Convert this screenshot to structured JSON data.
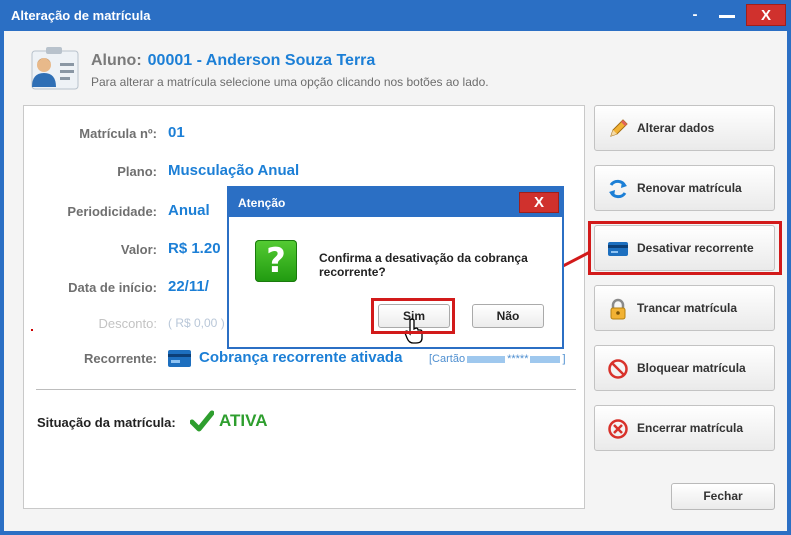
{
  "window": {
    "title": "Alteração de matrícula",
    "help_label": "-",
    "close_label": "X"
  },
  "header": {
    "aluno_label": "Aluno:",
    "aluno_value": "00001 - Anderson Souza Terra",
    "hint": "Para alterar a matrícula selecione uma opção clicando nos botões ao lado."
  },
  "info": {
    "matricula_label": "Matrícula nº:",
    "matricula_value": "01",
    "plano_label": "Plano:",
    "plano_value": "Musculação Anual",
    "periodicidade_label": "Periodicidade:",
    "periodicidade_value": "Anual",
    "valor_label": "Valor:",
    "valor_value": "R$ 1.20",
    "data_label": "Data de início:",
    "data_value": "22/11/",
    "desconto_label": "Desconto:",
    "desconto_value": "( R$ 0,00 )",
    "recorrente_label": "Recorrente:",
    "recorrente_value": "Cobrança recorrente ativada",
    "cartao_prefix": "[Cartão",
    "cartao_mask": "*****",
    "cartao_suffix": "]",
    "situacao_label": "Situação da matrícula:",
    "situacao_value": "ATIVA"
  },
  "actions": [
    {
      "label": "Alterar dados",
      "icon": "pencil-icon"
    },
    {
      "label": "Renovar matrícula",
      "icon": "refresh-icon"
    },
    {
      "label": "Desativar recorrente",
      "icon": "credit-card-icon"
    },
    {
      "label": "Trancar matrícula",
      "icon": "lock-icon"
    },
    {
      "label": "Bloquear matrícula",
      "icon": "block-icon"
    },
    {
      "label": "Encerrar matrícula",
      "icon": "cancel-circle-icon"
    }
  ],
  "fechar_label": "Fechar",
  "dialog": {
    "title": "Atenção",
    "close_label": "X",
    "message": "Confirma a desativação da cobrança recorrente?",
    "yes_label": "Sim",
    "no_label": "Não",
    "icon": "question-icon"
  },
  "colors": {
    "titlebar": "#2b6fc4",
    "accent_text": "#1c7fd6",
    "highlight": "#d21a1a",
    "status_ok": "#2e9e2e"
  }
}
